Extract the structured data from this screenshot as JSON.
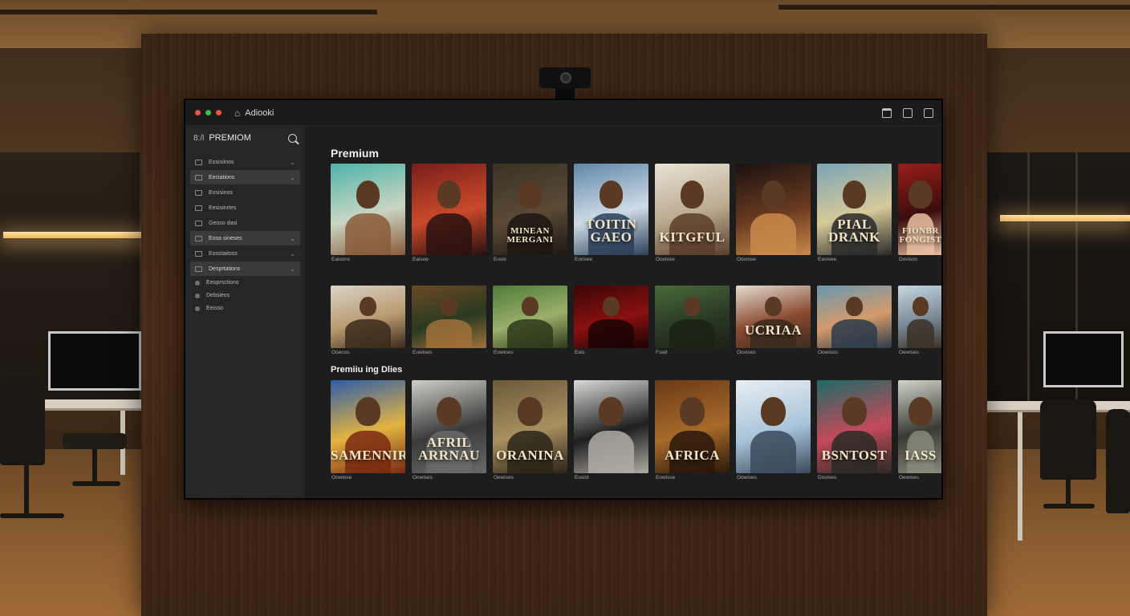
{
  "window": {
    "title": "Adiooki",
    "traffic_lights": [
      "#e5534b",
      "#3fb950",
      "#e5534b"
    ]
  },
  "sidebar": {
    "brand_prefix": "8:/l",
    "brand": "PREMIOM",
    "items": [
      {
        "label": "Eosisiinos",
        "active": false,
        "chevron": true
      },
      {
        "label": "Eeciations",
        "active": true,
        "chevron": true
      },
      {
        "label": "Eosisinos",
        "active": false,
        "chevron": false
      },
      {
        "label": "Eesisinrtes",
        "active": false,
        "chevron": false
      },
      {
        "label": "Geoso dasi",
        "active": false,
        "chevron": false
      },
      {
        "label": "Eosa sineses",
        "active": true,
        "chevron": true
      },
      {
        "label": "Eosstaitoss",
        "active": false,
        "chevron": true
      },
      {
        "label": "Desprtations",
        "active": true,
        "chevron": true
      },
      {
        "label": "Eeoprsctions",
        "active": false,
        "chevron": false,
        "sub": true
      },
      {
        "label": "Debsieos",
        "active": false,
        "chevron": false,
        "sub": true
      },
      {
        "label": "Eeisso",
        "active": false,
        "chevron": false,
        "sub": true
      }
    ]
  },
  "sections": {
    "premium": "Premium",
    "second": "Premiiu ing Dlies"
  },
  "rows": [
    {
      "captions": [
        "Eaisons",
        "Eaisoe",
        "Eosis",
        "Eorisee",
        "Ooviose",
        "Ooviose",
        "Eavisee",
        "Dovisos"
      ],
      "poster_texts": [
        "",
        "",
        "MINEAN MERGANI",
        "TOITIN GAEO",
        "KITGFUL",
        "",
        "PIAL DRANK",
        "FIONBR FONGIST"
      ]
    },
    {
      "captions": [
        "Ooecos",
        "Eowises",
        "Eowioes",
        "Eeis",
        "Fsed",
        "Oovises",
        "Oowisos",
        "Oewises"
      ],
      "poster_texts": [
        "",
        "",
        "",
        "",
        "",
        "UCRIAA",
        "",
        ""
      ]
    },
    {
      "captions": [
        "Oowiose",
        "Oowises",
        "Oewises",
        "Eosist",
        "Eowisse",
        "Oowises",
        "Dovises",
        "Oewises"
      ],
      "poster_texts": [
        "SAMENNIRI",
        "AFRIL ARRNAU",
        "ORANINA",
        "",
        "AFRICA",
        "",
        "BSNTOST",
        "IASS"
      ]
    }
  ]
}
